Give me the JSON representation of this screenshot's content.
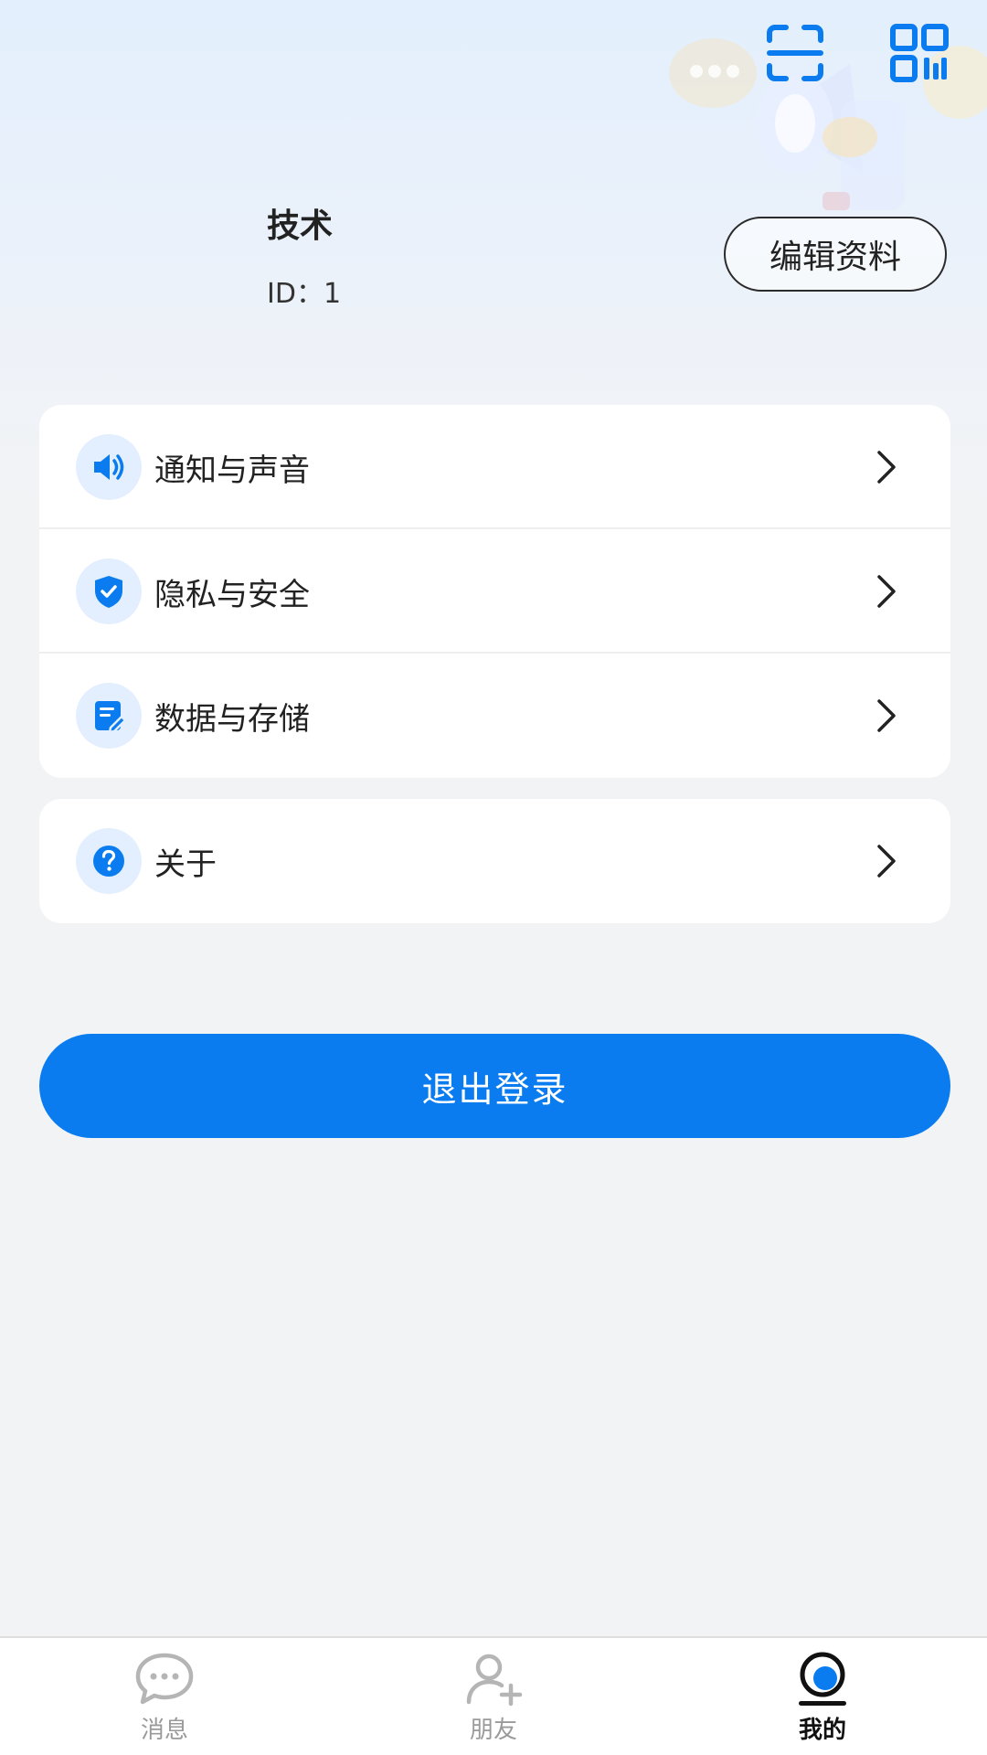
{
  "profile": {
    "name": "技术",
    "id_text": "ID：1",
    "edit_label": "编辑资料"
  },
  "menu": {
    "items": [
      {
        "label": "通知与声音",
        "icon": "speaker-icon"
      },
      {
        "label": "隐私与安全",
        "icon": "shield-check-icon"
      },
      {
        "label": "数据与存储",
        "icon": "document-edit-icon"
      }
    ],
    "about": {
      "label": "关于",
      "icon": "question-icon"
    }
  },
  "logout_label": "退出登录",
  "tabbar": {
    "tabs": [
      {
        "label": "消息",
        "icon": "chat-bubble-icon",
        "active": false
      },
      {
        "label": "朋友",
        "icon": "add-friend-icon",
        "active": false
      },
      {
        "label": "我的",
        "icon": "profile-icon",
        "active": true
      }
    ]
  },
  "colors": {
    "accent": "#0a7cf0",
    "icon_bg": "#e3efff",
    "inactive_tab": "#9a9a9a"
  }
}
